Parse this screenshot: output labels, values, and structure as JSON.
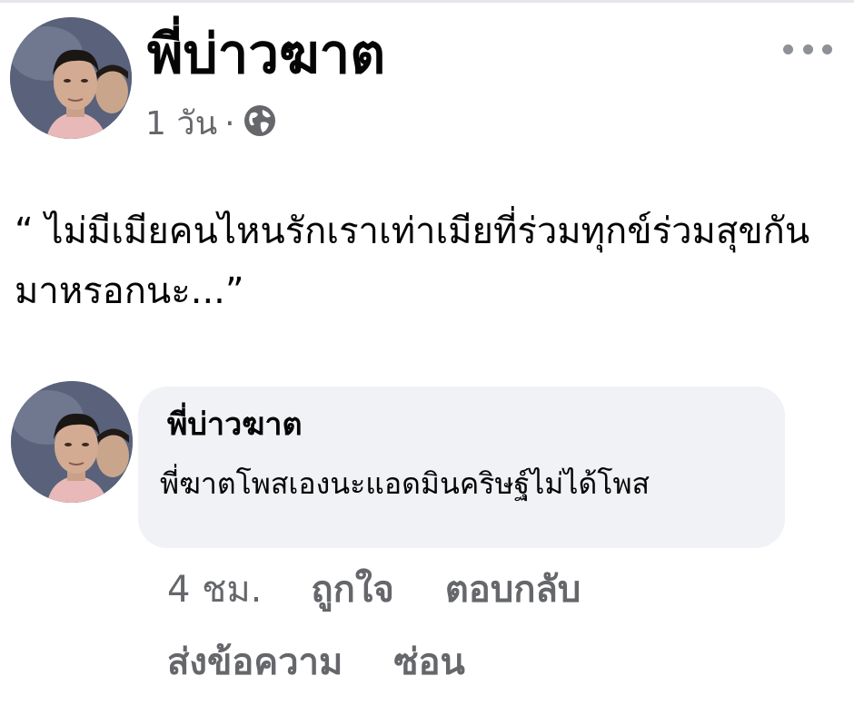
{
  "post": {
    "author": "พี่บ่าวฆาต",
    "time": "1 วัน",
    "separator": "·",
    "privacy_icon": "globe-icon",
    "more_icon": "more-options-icon",
    "text": "“ ไม่มีเมียคนไหนรักเราเท่าเมียที่ร่วมทุกข์ร่วมสุขกันมาหรอกนะ...”"
  },
  "comment": {
    "author": "พี่บ่าวฆาต",
    "text": "พี่ฆาตโพสเองนะแอดมินคริษฐ์ไม่ได้โพส",
    "time": "4 ชม.",
    "like_label": "ถูกใจ",
    "reply_label": "ตอบกลับ",
    "message_label": "ส่งข้อความ",
    "hide_label": "ซ่อน"
  },
  "colors": {
    "text_primary": "#050505",
    "text_secondary": "#65676b",
    "bubble_bg": "#f0f2f5"
  }
}
